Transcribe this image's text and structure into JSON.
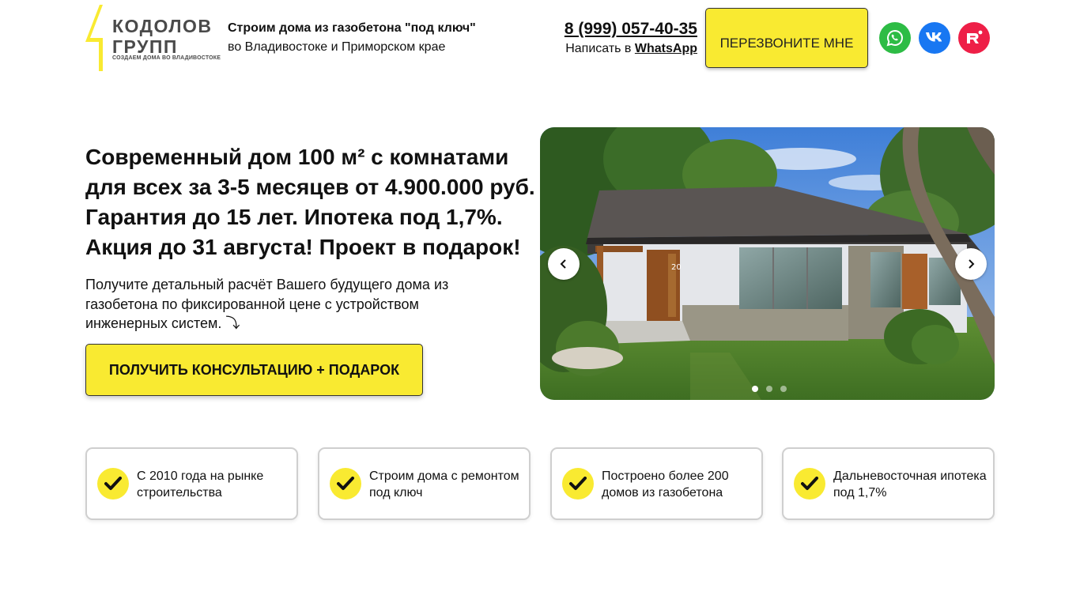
{
  "header": {
    "logo": {
      "line1": "КОДОЛОВ",
      "line2": "ГРУПП",
      "subline": "СОЗДАЕМ ДОМА ВО ВЛАДИВОСТОКЕ",
      "accent_color": "#f9ea31"
    },
    "tagline_bold": "Строим дома из газобетона \"под ключ\"",
    "tagline_regular": "во Владивостоке и Приморском крае",
    "phone": "8 (999) 057-40-35",
    "write_prefix": "Написать в",
    "write_link": "WhatsApp",
    "callback_button": "ПЕРЕЗВОНИТЕ МНЕ",
    "social": [
      {
        "icon": "whatsapp-icon",
        "color": "#2dbc45"
      },
      {
        "icon": "vk-icon",
        "color": "#1877f2"
      },
      {
        "icon": "rutube-icon",
        "color": "#ee1f47"
      }
    ]
  },
  "hero": {
    "title": "Современный дом 100 м² с комнатами для всех за 3-5 месяцев от 4.900.000 руб. Гарантия до 15 лет. Ипотека под 1,7%. Акция до 31 августа! Проект в подарок!",
    "subtitle": "Получите детальный расчёт Вашего будущего дома из газобетона по фиксированной цене с устройством инженерных систем. ⤵",
    "cta_button": "ПОЛУЧИТЬ КОНСУЛЬТАЦИЮ + ПОДАРОК"
  },
  "slider": {
    "house_number": "20",
    "slides_count": 3,
    "active_slide": 1
  },
  "features": [
    {
      "text": "С 2010 года на рынке строительства"
    },
    {
      "text": "Строим дома с ремонтом под ключ"
    },
    {
      "text": "Построено более 200 домов из газобетона"
    },
    {
      "text": "Дальневосточная ипотека под 1,7%"
    }
  ],
  "colors": {
    "accent_yellow": "#f9ea31",
    "text": "#111111",
    "card_border": "#cfcfcf"
  }
}
